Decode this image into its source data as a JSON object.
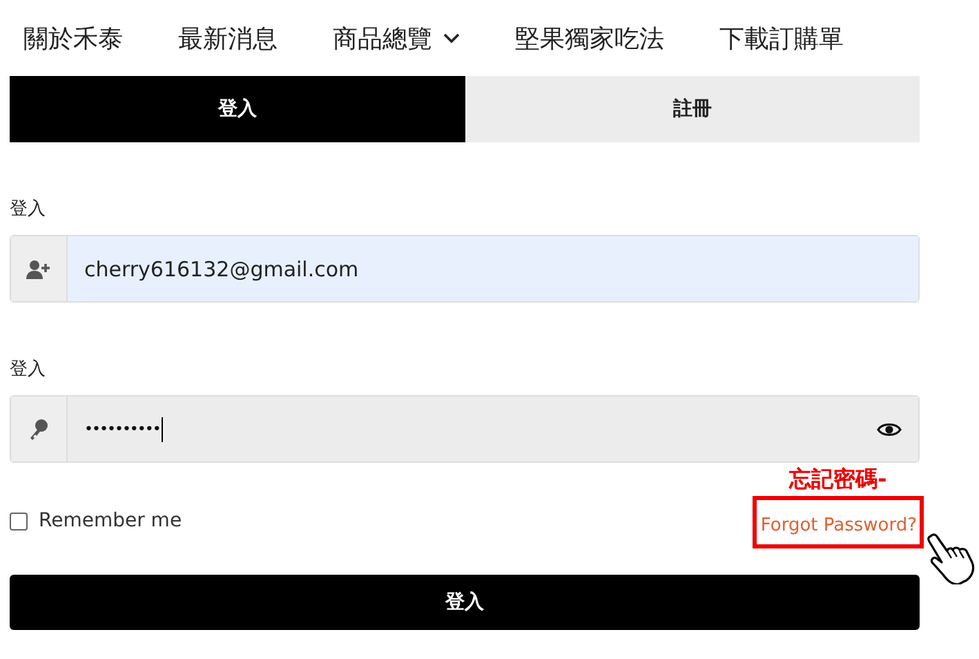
{
  "nav": [
    {
      "label": "關於禾泰",
      "dropdown": false
    },
    {
      "label": "最新消息",
      "dropdown": false
    },
    {
      "label": "商品總覽",
      "dropdown": true
    },
    {
      "label": "堅果獨家吃法",
      "dropdown": false
    },
    {
      "label": "下載訂購單",
      "dropdown": false
    }
  ],
  "tabs": [
    {
      "label": "登入",
      "selected": true
    },
    {
      "label": "註冊",
      "selected": false
    }
  ],
  "fields": [
    {
      "kind": "email",
      "label": "登入",
      "value": "cherry616132@gmail.com",
      "autofilled": true
    },
    {
      "kind": "password",
      "label": "登入",
      "value": "••••••••••",
      "autofilled": false
    }
  ],
  "remember": {
    "label": "Remember me",
    "checked": false
  },
  "forgot": {
    "label": "Forgot Password?",
    "note": "忘記密碼-"
  },
  "submit": "登入"
}
